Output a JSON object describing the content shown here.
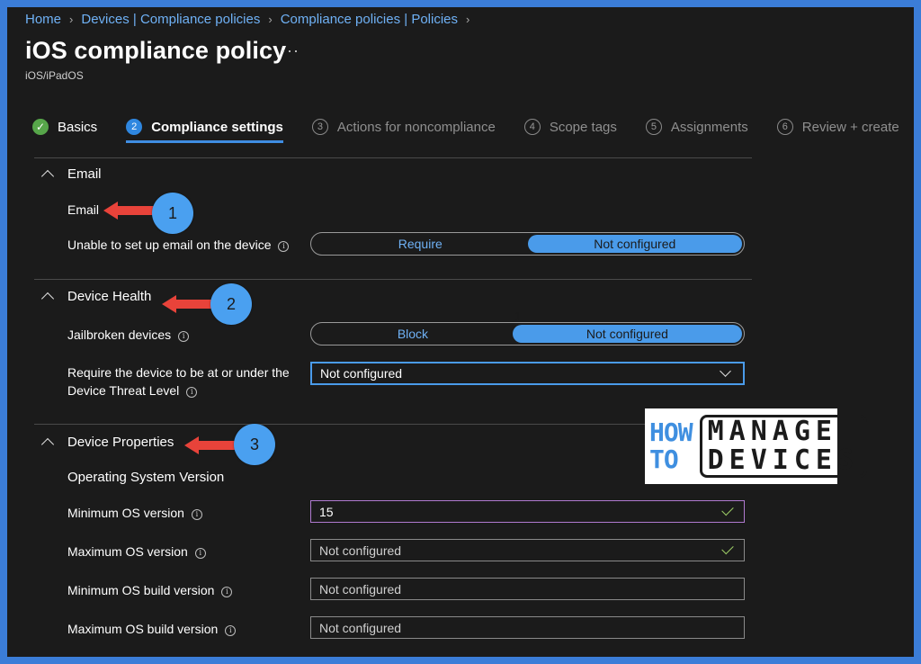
{
  "breadcrumb": [
    "Home",
    "Devices | Compliance policies",
    "Compliance policies | Policies"
  ],
  "title": "iOS compliance policy",
  "more": "···",
  "subtitle": "iOS/iPadOS",
  "steps": [
    {
      "num": "✓",
      "label": "Basics",
      "state": "done"
    },
    {
      "num": "2",
      "label": "Compliance settings",
      "state": "active"
    },
    {
      "num": "3",
      "label": "Actions for noncompliance",
      "state": "pending"
    },
    {
      "num": "4",
      "label": "Scope tags",
      "state": "pending"
    },
    {
      "num": "5",
      "label": "Assignments",
      "state": "pending"
    },
    {
      "num": "6",
      "label": "Review + create",
      "state": "pending"
    }
  ],
  "sections": {
    "email": {
      "title": "Email",
      "subheading": "Email",
      "setting_label": "Unable to set up email on the device",
      "options": [
        "Require",
        "Not configured"
      ],
      "selected": "Not configured"
    },
    "health": {
      "title": "Device Health",
      "jailbroken_label": "Jailbroken devices",
      "options": [
        "Block",
        "Not configured"
      ],
      "selected": "Not configured",
      "threat_label_line1": "Require the device to be at or under the",
      "threat_label_line2": "Device Threat Level",
      "threat_value": "Not configured"
    },
    "properties": {
      "title": "Device Properties",
      "subheading": "Operating System Version",
      "fields": [
        {
          "label": "Minimum OS version",
          "value": "15"
        },
        {
          "label": "Maximum OS version",
          "value": "Not configured"
        },
        {
          "label": "Minimum OS build version",
          "value": "Not configured"
        },
        {
          "label": "Maximum OS build version",
          "value": "Not configured"
        }
      ]
    }
  },
  "annotations": [
    "1",
    "2",
    "3"
  ],
  "stray_mark": "1",
  "logo": {
    "left": [
      "HOW",
      "TO"
    ],
    "right": [
      "MANAGE",
      "DEVICES"
    ]
  },
  "colors": {
    "accent": "#4a9bea",
    "link": "#6fb1f5",
    "arrow": "#e8433a",
    "success": "#57a64a",
    "background": "#1b1b1b",
    "border": "#3b7dd8"
  }
}
